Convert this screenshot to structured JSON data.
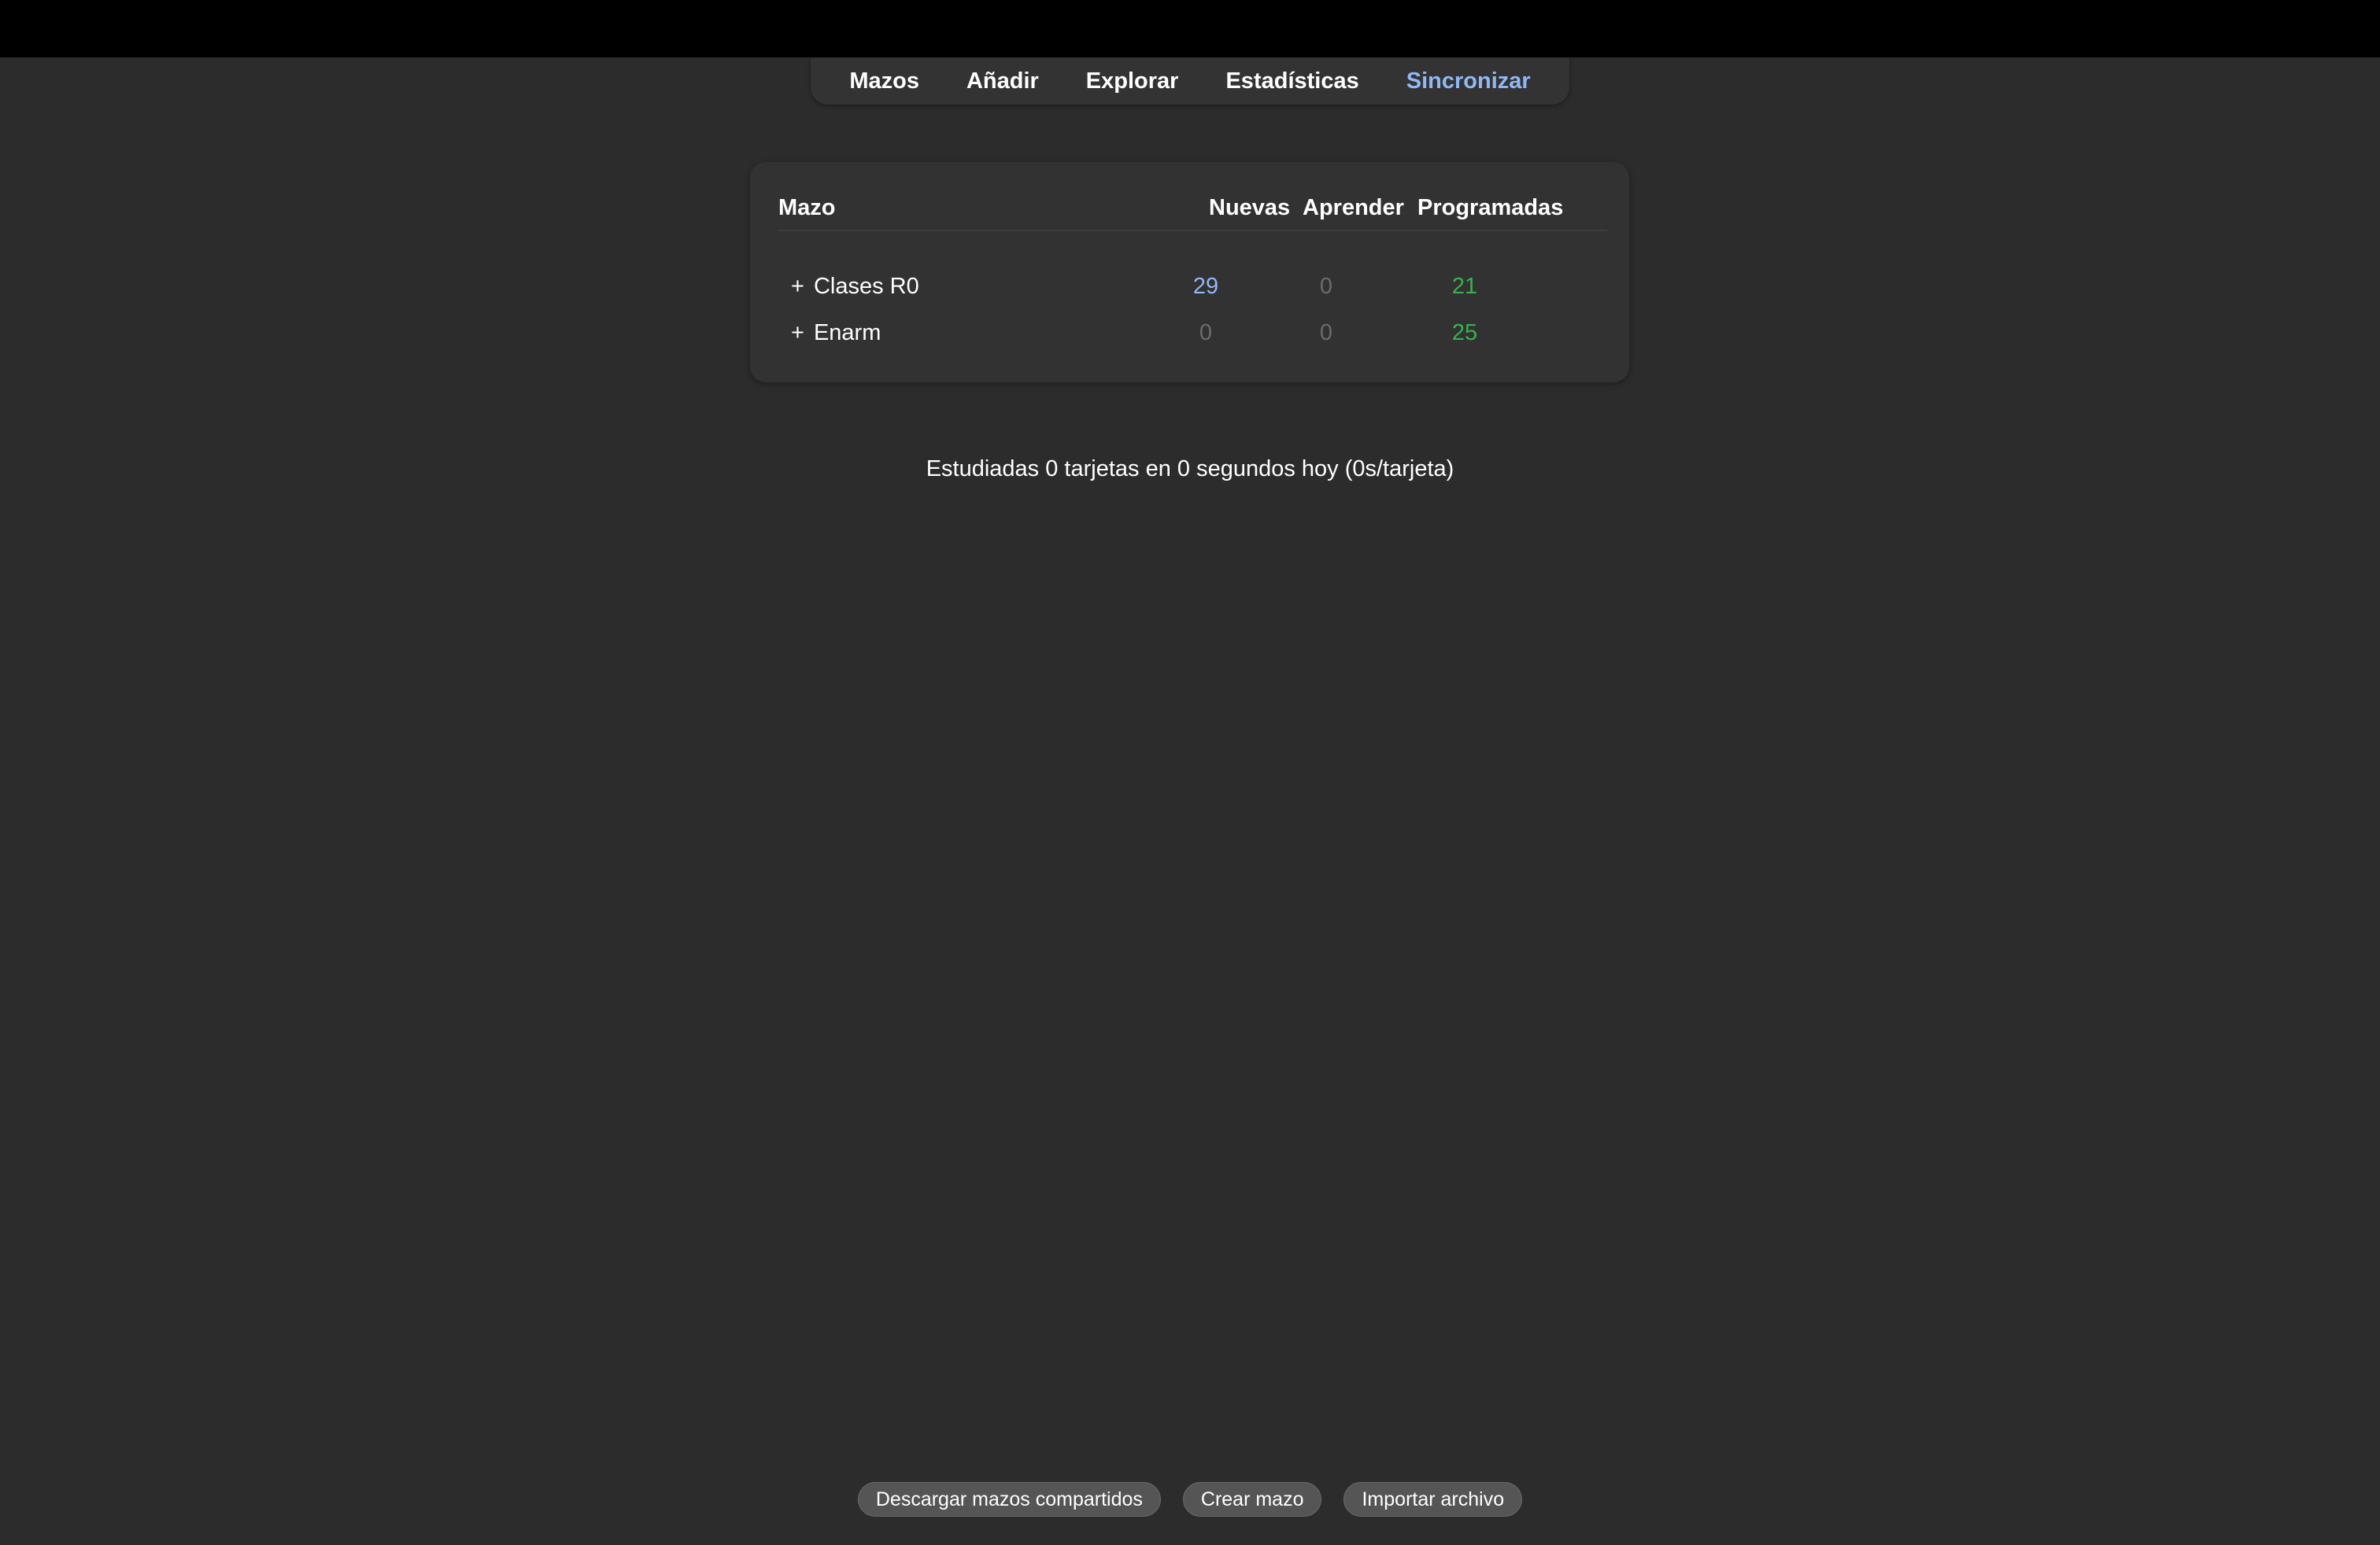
{
  "nav": {
    "items": [
      {
        "label": "Mazos"
      },
      {
        "label": "Añadir"
      },
      {
        "label": "Explorar"
      },
      {
        "label": "Estadísticas"
      },
      {
        "label": "Sincronizar",
        "active": true
      }
    ]
  },
  "decks": {
    "columns": {
      "deck": "Mazo",
      "new": "Nuevas",
      "learn": "Aprender",
      "due": "Programadas"
    },
    "rows": [
      {
        "expand": "+",
        "name": "Clases R0",
        "new": "29",
        "learn": "0",
        "due": "21"
      },
      {
        "expand": "+",
        "name": "Enarm",
        "new": "0",
        "learn": "0",
        "due": "25"
      }
    ]
  },
  "studied_text": "Estudiadas 0 tarjetas en 0 segundos hoy (0s/tarjeta)",
  "buttons": {
    "shared": "Descargar mazos compartidos",
    "create": "Crear mazo",
    "import": "Importar archivo"
  },
  "colors": {
    "new": "#8fb8f5",
    "zero": "#6b6b6b",
    "due": "#37b24d",
    "active_nav": "#8fb8f5"
  }
}
